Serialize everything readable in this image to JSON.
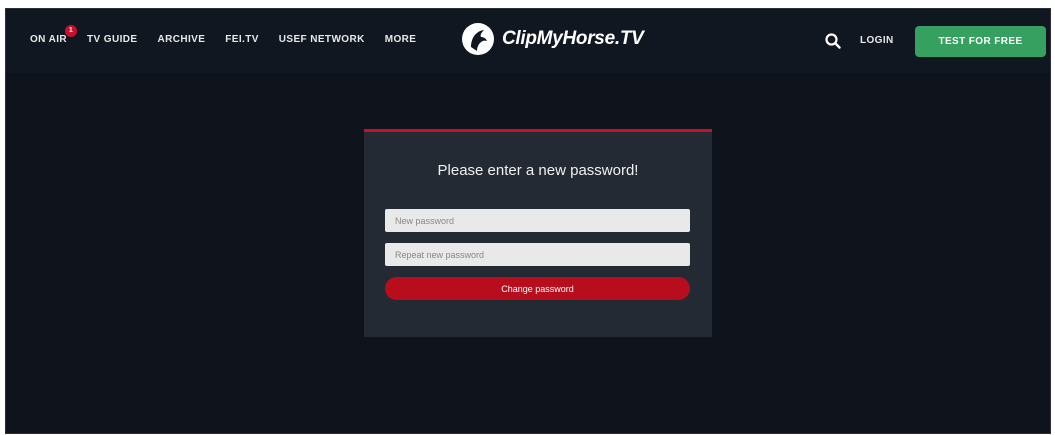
{
  "nav": {
    "items": [
      {
        "label": "ON AIR",
        "badge": "1"
      },
      {
        "label": "TV GUIDE"
      },
      {
        "label": "ARCHIVE"
      },
      {
        "label": "FEI.TV"
      },
      {
        "label": "USEF NETWORK"
      },
      {
        "label": "MORE"
      }
    ]
  },
  "brand": {
    "name": "ClipMyHorse.TV"
  },
  "header": {
    "search_icon": "search-icon",
    "login_label": "LOGIN",
    "cta_label": "TEST FOR FREE"
  },
  "form": {
    "title": "Please enter a new password!",
    "new_password_placeholder": "New password",
    "repeat_password_placeholder": "Repeat new password",
    "submit_label": "Change password"
  },
  "colors": {
    "background": "#0f141c",
    "card": "#232a33",
    "accent_red": "#c8102e",
    "cta_green": "#35a05f"
  }
}
